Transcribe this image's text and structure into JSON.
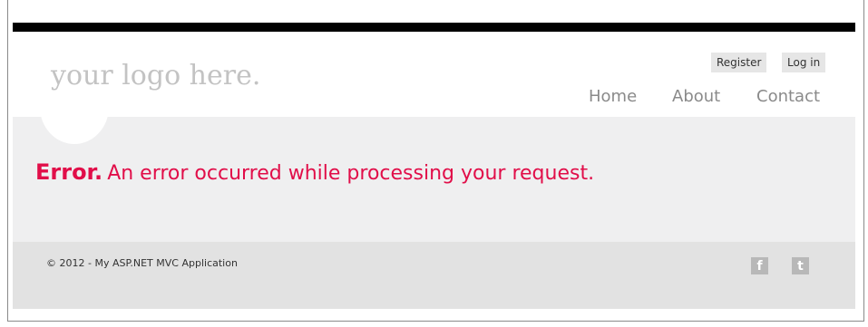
{
  "header": {
    "logo_text": "your logo here.",
    "auth": {
      "register_label": "Register",
      "login_label": "Log in"
    },
    "nav": {
      "home_label": "Home",
      "about_label": "About",
      "contact_label": "Contact"
    }
  },
  "main": {
    "error_title": "Error.",
    "error_message": "An error occurred while processing your request."
  },
  "footer": {
    "copyright": "© 2012 - My ASP.NET MVC Application",
    "social": {
      "facebook_icon": "facebook-icon",
      "facebook_glyph": "f",
      "twitter_icon": "twitter-icon",
      "twitter_glyph": "t"
    }
  },
  "colors": {
    "accent": "#e10e49",
    "logo_gray": "#c3c3c3",
    "nav_gray": "#8a8a8a",
    "featured_bg": "#efeff0",
    "footer_bg": "#e2e2e2",
    "topbar": "#000000"
  }
}
